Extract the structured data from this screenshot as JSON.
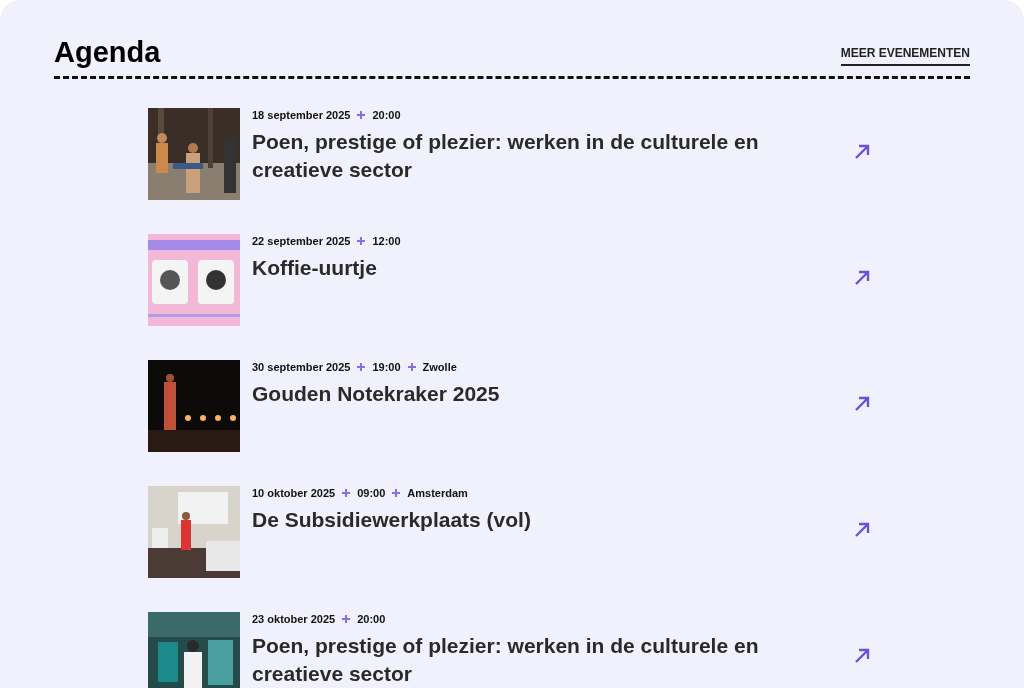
{
  "heading": "Agenda",
  "more_link": "MEER EVENEMENTEN",
  "events": [
    {
      "meta": [
        "18 september 2025",
        "20:00"
      ],
      "title": "Poen, prestige of plezier: werken in de culturele en creatieve sector"
    },
    {
      "meta": [
        "22 september 2025",
        "12:00"
      ],
      "title": "Koffie-uurtje"
    },
    {
      "meta": [
        "30 september 2025",
        "19:00",
        "Zwolle"
      ],
      "title": "Gouden Notekraker 2025"
    },
    {
      "meta": [
        "10 oktober 2025",
        "09:00",
        "Amsterdam"
      ],
      "title": "De Subsidiewerkplaats (vol)"
    },
    {
      "meta": [
        "23 oktober 2025",
        "20:00"
      ],
      "title": "Poen, prestige of plezier: werken in de culturele en creatieve sector"
    }
  ]
}
